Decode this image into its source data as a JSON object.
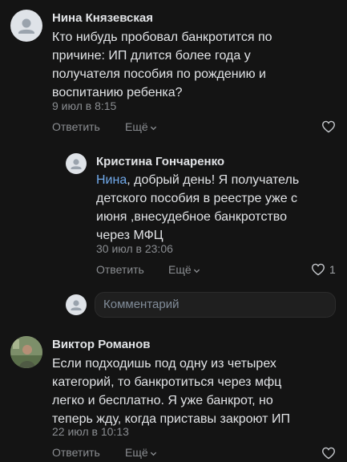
{
  "comments": [
    {
      "author": "Нина Князевская",
      "text_lines": [
        "Кто нибудь пробовал банкротится по",
        "причине: ИП длится более года у",
        "получателя пособия по рождению и",
        "воспитанию ребенка?"
      ],
      "time": "9 июл в 8:15",
      "reply_label": "Ответить",
      "more_label": "Ещё"
    },
    {
      "author": "Кристина Гончаренко",
      "mention": "Нина",
      "text_first_rest": ", добрый день! Я получатель",
      "text_lines": [
        "детского пособия в реестре уже с",
        "июня ,внесудебное банкротство",
        "через МФЦ"
      ],
      "time": "30 июл в 23:06",
      "reply_label": "Ответить",
      "more_label": "Ещё",
      "likes": "1"
    },
    {
      "author": "Виктор Романов",
      "text_lines": [
        "Если подходишь под одну из четырех",
        "категорий, то банкротиться через мфц",
        "легко и бесплатно. Я уже банкрот, но",
        "теперь жду, когда приставы закроют ИП"
      ],
      "time": "22 июл в 10:13",
      "reply_label": "Ответить",
      "more_label": "Ещё"
    }
  ],
  "reply_input": {
    "placeholder": "Комментарий"
  },
  "colors": {
    "background": "#141414",
    "text": "#e1e3e6",
    "muted": "#8a8d91",
    "link": "#71aaeb"
  },
  "icons": [
    "user-avatar-icon",
    "heart-icon",
    "chevron-down-icon"
  ]
}
